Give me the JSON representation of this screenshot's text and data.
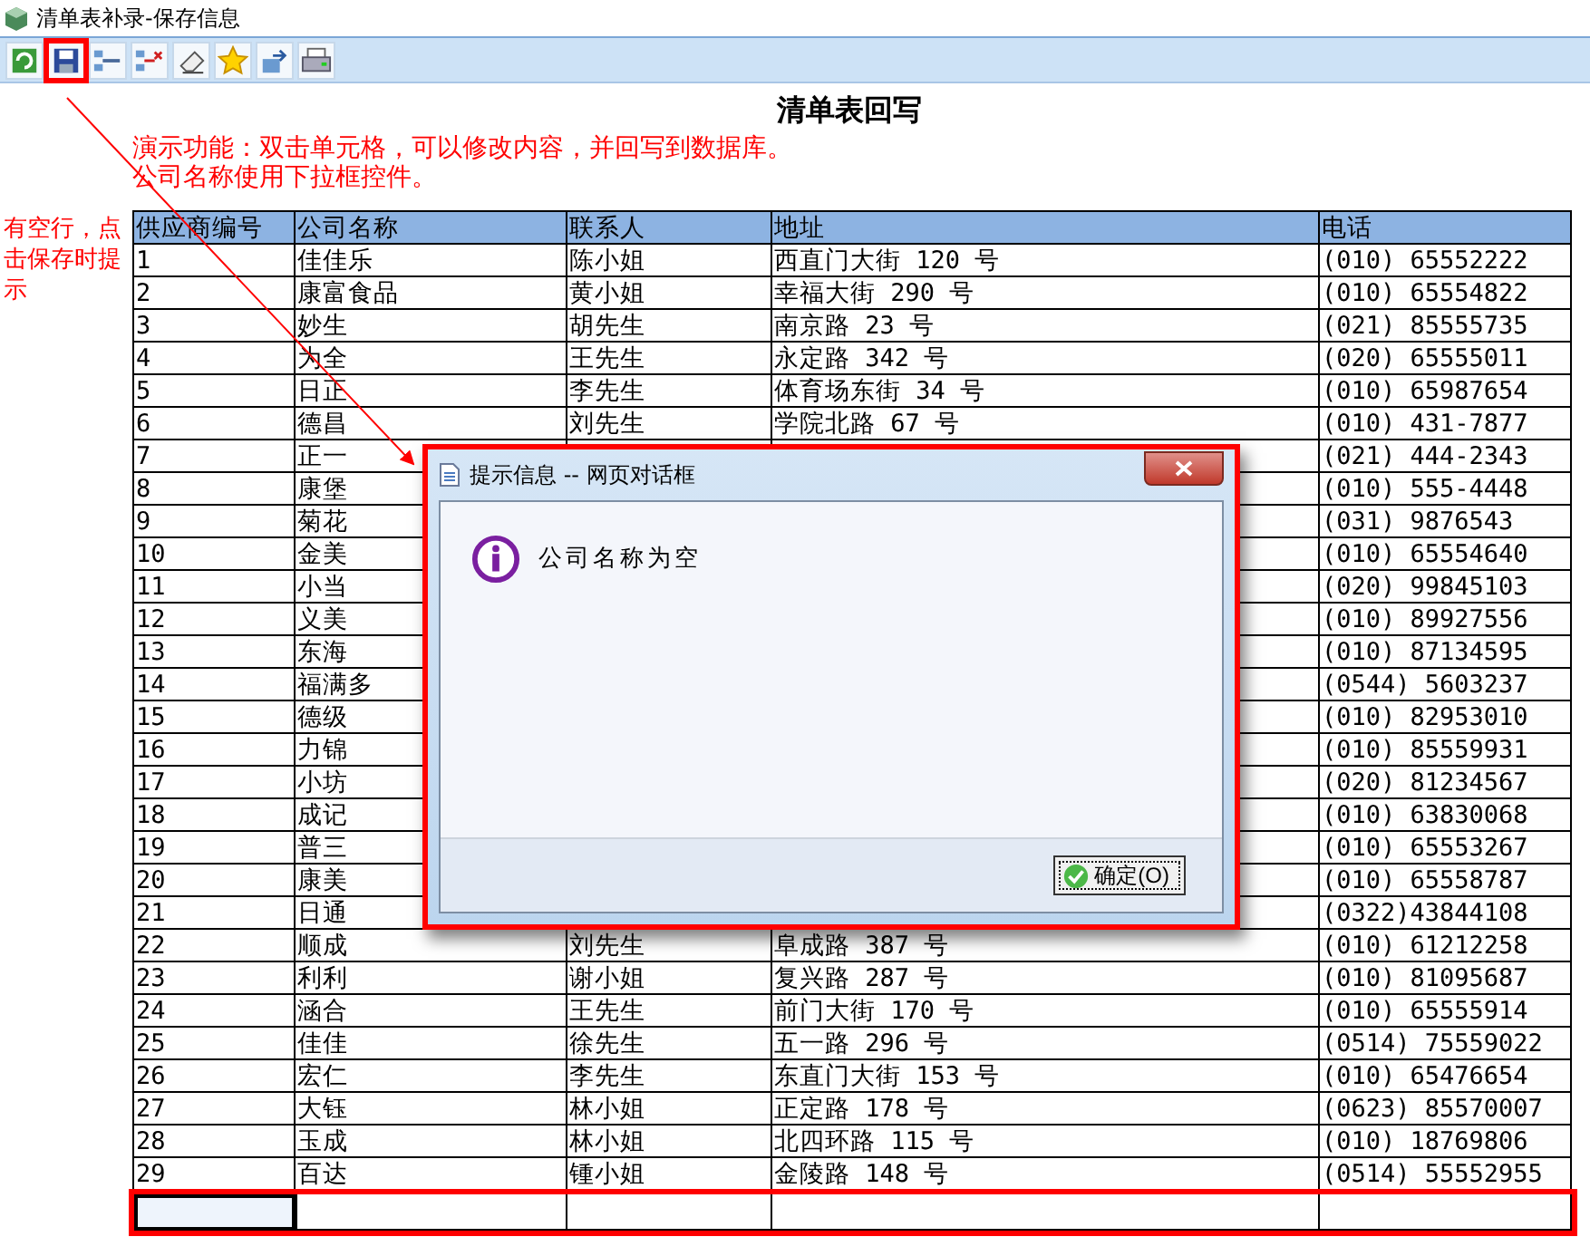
{
  "window": {
    "title": "清单表补录-保存信息"
  },
  "page": {
    "heading": "清单表回写",
    "notes": [
      "演示功能：双击单元格，可以修改内容，并回写到数据库。",
      "公司名称使用下拉框控件。"
    ]
  },
  "annotation": {
    "callout": "有空行，点击保存时提示"
  },
  "table": {
    "columns": [
      "供应商编号",
      "公司名称",
      "联系人",
      "地址",
      "电话"
    ],
    "rows": [
      {
        "id": "1",
        "company": "佳佳乐",
        "contact": "陈小姐",
        "address": "西直门大街 120 号",
        "phone": "(010) 65552222"
      },
      {
        "id": "2",
        "company": "康富食品",
        "contact": "黄小姐",
        "address": "幸福大街 290 号",
        "phone": "(010) 65554822"
      },
      {
        "id": "3",
        "company": "妙生",
        "contact": "胡先生",
        "address": "南京路 23 号",
        "phone": "(021) 85555735"
      },
      {
        "id": "4",
        "company": "为全",
        "contact": "王先生",
        "address": "永定路 342 号",
        "phone": "(020) 65555011"
      },
      {
        "id": "5",
        "company": "日正",
        "contact": "李先生",
        "address": "体育场东街 34 号",
        "phone": "(010) 65987654"
      },
      {
        "id": "6",
        "company": "德昌",
        "contact": "刘先生",
        "address": "学院北路 67 号",
        "phone": "(010) 431-7877"
      },
      {
        "id": "7",
        "company": "正一",
        "phone": "(021) 444-2343"
      },
      {
        "id": "8",
        "company": "康堡",
        "phone": "(010) 555-4448"
      },
      {
        "id": "9",
        "company": "菊花",
        "phone": "(031) 9876543"
      },
      {
        "id": "10",
        "company": "金美",
        "phone": "(010) 65554640"
      },
      {
        "id": "11",
        "company": "小当",
        "phone": "(020) 99845103"
      },
      {
        "id": "12",
        "company": "义美",
        "phone": "(010) 89927556"
      },
      {
        "id": "13",
        "company": "东海",
        "phone": "(010) 87134595"
      },
      {
        "id": "14",
        "company": "福满多",
        "phone": "(0544) 5603237"
      },
      {
        "id": "15",
        "company": "德级",
        "phone": "(010) 82953010"
      },
      {
        "id": "16",
        "company": "力锦",
        "phone": "(010) 85559931"
      },
      {
        "id": "17",
        "company": "小坊",
        "phone": "(020) 81234567"
      },
      {
        "id": "18",
        "company": "成记",
        "phone": "(010) 63830068"
      },
      {
        "id": "19",
        "company": "普三",
        "phone": "(010) 65553267"
      },
      {
        "id": "20",
        "company": "康美",
        "phone": "(010) 65558787"
      },
      {
        "id": "21",
        "company": "日通",
        "phone": "(0322)43844108"
      },
      {
        "id": "22",
        "company": "顺成",
        "contact": "刘先生",
        "address": "阜成路 387 号",
        "phone": "(010) 61212258"
      },
      {
        "id": "23",
        "company": "利利",
        "contact": "谢小姐",
        "address": "复兴路 287 号",
        "phone": "(010) 81095687"
      },
      {
        "id": "24",
        "company": "涵合",
        "contact": "王先生",
        "address": "前门大街 170 号",
        "phone": "(010) 65555914"
      },
      {
        "id": "25",
        "company": "佳佳",
        "contact": "徐先生",
        "address": "五一路 296 号",
        "phone": "(0514) 75559022"
      },
      {
        "id": "26",
        "company": "宏仁",
        "contact": "李先生",
        "address": "东直门大街 153 号",
        "phone": "(010) 65476654"
      },
      {
        "id": "27",
        "company": "大钰",
        "contact": "林小姐",
        "address": "正定路 178 号",
        "phone": "(0623) 85570007"
      },
      {
        "id": "28",
        "company": "玉成",
        "contact": "林小姐",
        "address": "北四环路 115 号",
        "phone": "(010) 18769806"
      },
      {
        "id": "29",
        "company": "百达",
        "contact": "锺小姐",
        "address": "金陵路 148 号",
        "phone": "(0514) 55552955"
      }
    ],
    "blank_row": {
      "cells": [
        {
          "selected": true
        },
        {
          "selected": false
        },
        {
          "selected": false
        },
        {
          "selected": false
        },
        {
          "selected": false
        }
      ]
    }
  },
  "dialog": {
    "title": "提示信息 -- 网页对话框",
    "message": "公司名称为空",
    "button": "确定(O)"
  }
}
